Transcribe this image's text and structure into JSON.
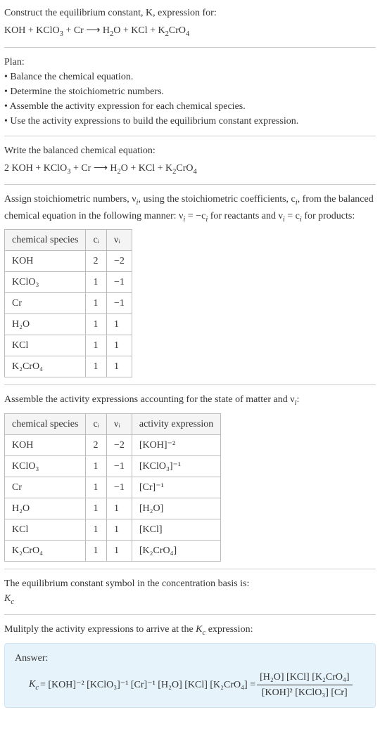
{
  "header": {
    "prompt": "Construct the equilibrium constant, K, expression for:",
    "unbalanced_lhs": "KOH + KClO",
    "unbalanced_lhs2": " + Cr ⟶ H",
    "unbalanced_mid": "O + KCl + K",
    "unbalanced_end": "CrO",
    "sub3": "3",
    "sub2": "2",
    "sub4": "4"
  },
  "plan": {
    "title": "Plan:",
    "items": [
      "Balance the chemical equation.",
      "Determine the stoichiometric numbers.",
      "Assemble the activity expression for each chemical species.",
      "Use the activity expressions to build the equilibrium constant expression."
    ]
  },
  "balanced": {
    "title": "Write the balanced chemical equation:",
    "eq_pre": "2 KOH + KClO",
    "eq_mid1": " + Cr ⟶ H",
    "eq_mid2": "O + KCl + K",
    "eq_end": "CrO",
    "sub3": "3",
    "sub2": "2",
    "sub4": "4"
  },
  "stoich": {
    "intro1": "Assign stoichiometric numbers, ν",
    "intro2": ", using the stoichiometric coefficients, c",
    "intro3": ", from the balanced chemical equation in the following manner: ν",
    "intro4": " = −c",
    "intro5": " for reactants and ν",
    "intro6": " = c",
    "intro7": " for products:",
    "subi": "i",
    "headers": [
      "chemical species",
      "cᵢ",
      "νᵢ"
    ],
    "rows": [
      {
        "sp": "KOH",
        "c": "2",
        "v": "−2"
      },
      {
        "sp": "KClO₃",
        "c": "1",
        "v": "−1"
      },
      {
        "sp": "Cr",
        "c": "1",
        "v": "−1"
      },
      {
        "sp": "H₂O",
        "c": "1",
        "v": "1"
      },
      {
        "sp": "KCl",
        "c": "1",
        "v": "1"
      },
      {
        "sp": "K₂CrO₄",
        "c": "1",
        "v": "1"
      }
    ]
  },
  "activity": {
    "intro1": "Assemble the activity expressions accounting for the state of matter and ν",
    "intro2": ":",
    "subi": "i",
    "headers": [
      "chemical species",
      "cᵢ",
      "νᵢ",
      "activity expression"
    ],
    "rows": [
      {
        "sp": "KOH",
        "c": "2",
        "v": "−2",
        "a": "[KOH]⁻²"
      },
      {
        "sp": "KClO₃",
        "c": "1",
        "v": "−1",
        "a": "[KClO₃]⁻¹"
      },
      {
        "sp": "Cr",
        "c": "1",
        "v": "−1",
        "a": "[Cr]⁻¹"
      },
      {
        "sp": "H₂O",
        "c": "1",
        "v": "1",
        "a": "[H₂O]"
      },
      {
        "sp": "KCl",
        "c": "1",
        "v": "1",
        "a": "[KCl]"
      },
      {
        "sp": "K₂CrO₄",
        "c": "1",
        "v": "1",
        "a": "[K₂CrO₄]"
      }
    ]
  },
  "symbol": {
    "line1": "The equilibrium constant symbol in the concentration basis is:",
    "kc_K": "K",
    "kc_c": "c"
  },
  "multiply": {
    "text1": "Mulitply the activity expressions to arrive at the ",
    "text2": " expression:",
    "kc_K": "K",
    "kc_c": "c"
  },
  "answer": {
    "label": "Answer:",
    "kc_K": "K",
    "kc_c": "c",
    "eq": " = [KOH]⁻² [KClO₃]⁻¹ [Cr]⁻¹ [H₂O] [KCl] [K₂CrO₄] = ",
    "num": "[H₂O] [KCl] [K₂CrO₄]",
    "den": "[KOH]² [KClO₃] [Cr]"
  },
  "chart_data": {
    "type": "table",
    "tables": [
      {
        "title": "Stoichiometric numbers",
        "columns": [
          "chemical species",
          "c_i",
          "ν_i"
        ],
        "rows": [
          [
            "KOH",
            2,
            -2
          ],
          [
            "KClO3",
            1,
            -1
          ],
          [
            "Cr",
            1,
            -1
          ],
          [
            "H2O",
            1,
            1
          ],
          [
            "KCl",
            1,
            1
          ],
          [
            "K2CrO4",
            1,
            1
          ]
        ]
      },
      {
        "title": "Activity expressions",
        "columns": [
          "chemical species",
          "c_i",
          "ν_i",
          "activity expression"
        ],
        "rows": [
          [
            "KOH",
            2,
            -2,
            "[KOH]^-2"
          ],
          [
            "KClO3",
            1,
            -1,
            "[KClO3]^-1"
          ],
          [
            "Cr",
            1,
            -1,
            "[Cr]^-1"
          ],
          [
            "H2O",
            1,
            1,
            "[H2O]"
          ],
          [
            "KCl",
            1,
            1,
            "[KCl]"
          ],
          [
            "K2CrO4",
            1,
            1,
            "[K2CrO4]"
          ]
        ]
      }
    ]
  }
}
